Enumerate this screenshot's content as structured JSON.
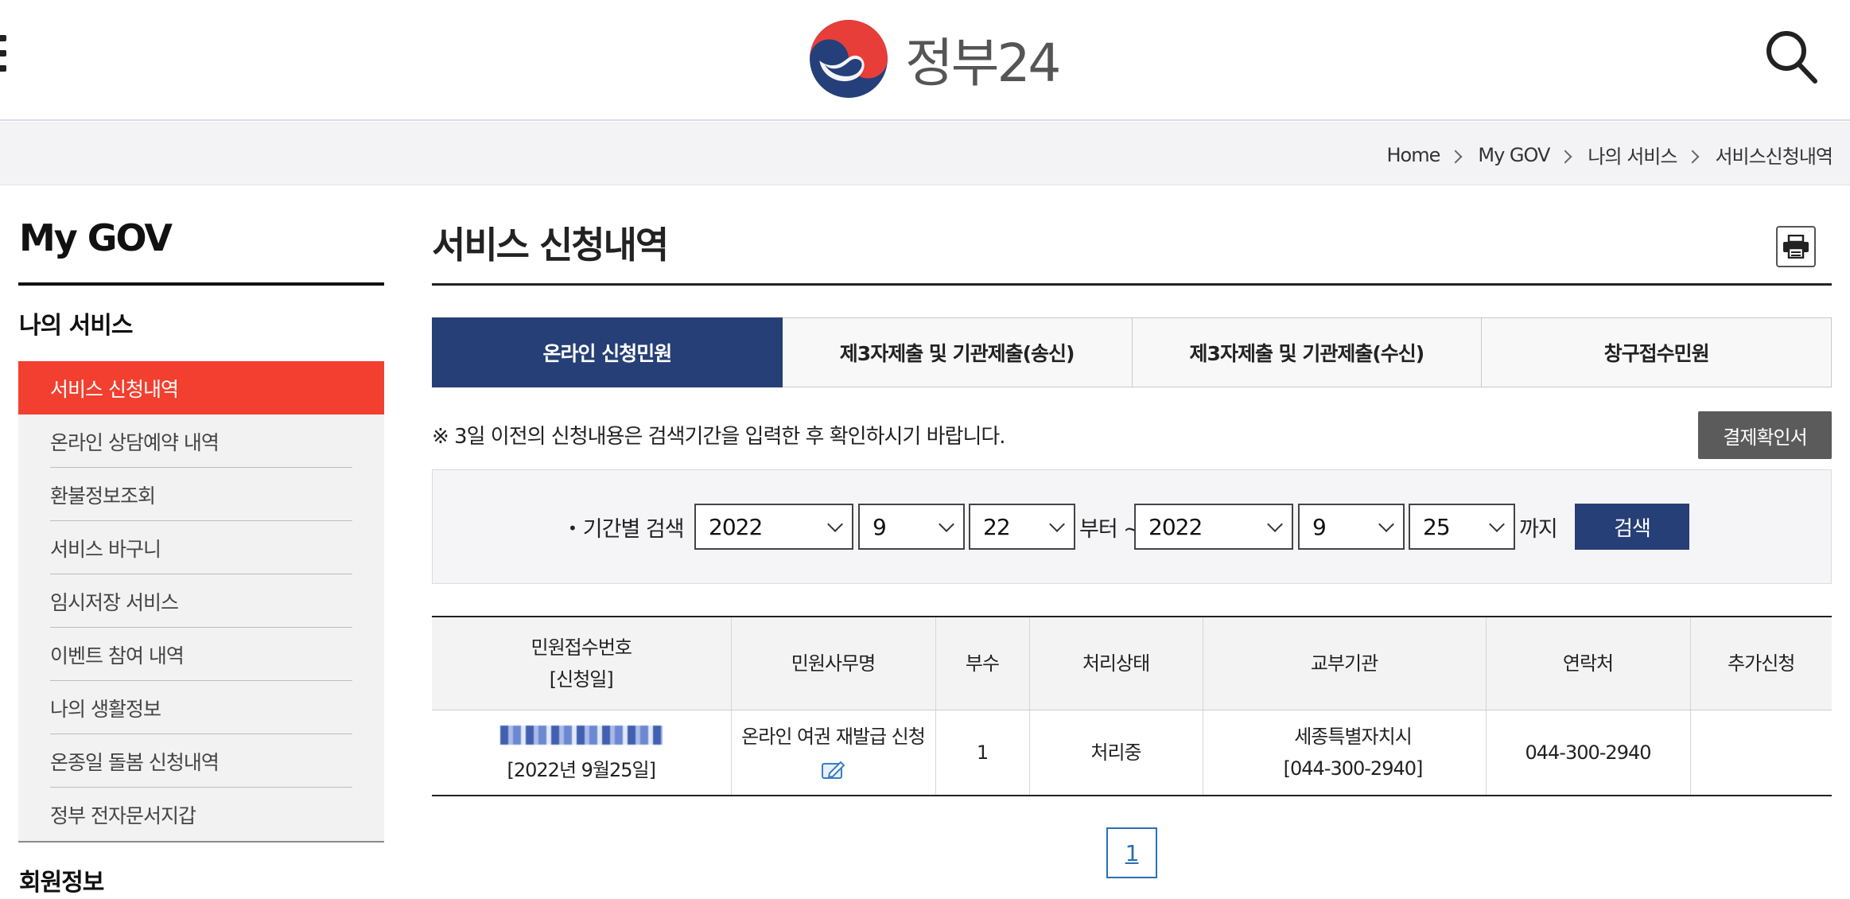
{
  "header": {
    "logo_text": "정부24",
    "menu_icon": "hamburger-menu-icon",
    "search_icon": "search-icon"
  },
  "breadcrumb": {
    "items": [
      "Home",
      "My GOV",
      "나의 서비스",
      "서비스신청내역"
    ]
  },
  "sidebar": {
    "title": "My GOV",
    "section": "나의 서비스",
    "items": [
      {
        "label": "서비스 신청내역",
        "active": true
      },
      {
        "label": "온라인 상담예약 내역"
      },
      {
        "label": "환불정보조회"
      },
      {
        "label": "서비스 바구니"
      },
      {
        "label": "임시저장 서비스"
      },
      {
        "label": "이벤트 참여 내역"
      },
      {
        "label": "나의 생활정보"
      },
      {
        "label": "온종일 돌봄 신청내역"
      },
      {
        "label": "정부 전자문서지갑"
      }
    ],
    "section2": "회원정보"
  },
  "main": {
    "title": "서비스 신청내역",
    "print_icon": "printer-icon",
    "tabs": [
      {
        "label": "온라인 신청민원",
        "active": true
      },
      {
        "label": "제3자제출 및 기관제출(송신)"
      },
      {
        "label": "제3자제출 및 기관제출(수신)"
      },
      {
        "label": "창구접수민원"
      }
    ],
    "notice": "※ 3일 이전의 신청내용은 검색기간을 입력한 후 확인하시기 바랍니다.",
    "receipt_button": "결제확인서",
    "search": {
      "label": "기간별 검색",
      "from": {
        "year": "2022",
        "month": "9",
        "day": "22"
      },
      "from_suffix": "부터 ~",
      "to": {
        "year": "2022",
        "month": "9",
        "day": "25"
      },
      "to_suffix": "까지",
      "button": "검색"
    },
    "table": {
      "headers": {
        "receipt_no_line1": "민원접수번호",
        "receipt_no_line2": "[신청일]",
        "name": "민원사무명",
        "copies": "부수",
        "status": "처리상태",
        "agency": "교부기관",
        "contact": "연락처",
        "extra": "추가신청"
      },
      "rows": [
        {
          "date": "[2022년 9월25일]",
          "name": "온라인 여권 재발급 신청",
          "copies": "1",
          "status": "처리중",
          "agency": "세종특별자치시",
          "agency_phone": "[044-300-2940]",
          "contact": "044-300-2940",
          "extra": ""
        }
      ]
    },
    "pagination": {
      "current": "1"
    }
  }
}
